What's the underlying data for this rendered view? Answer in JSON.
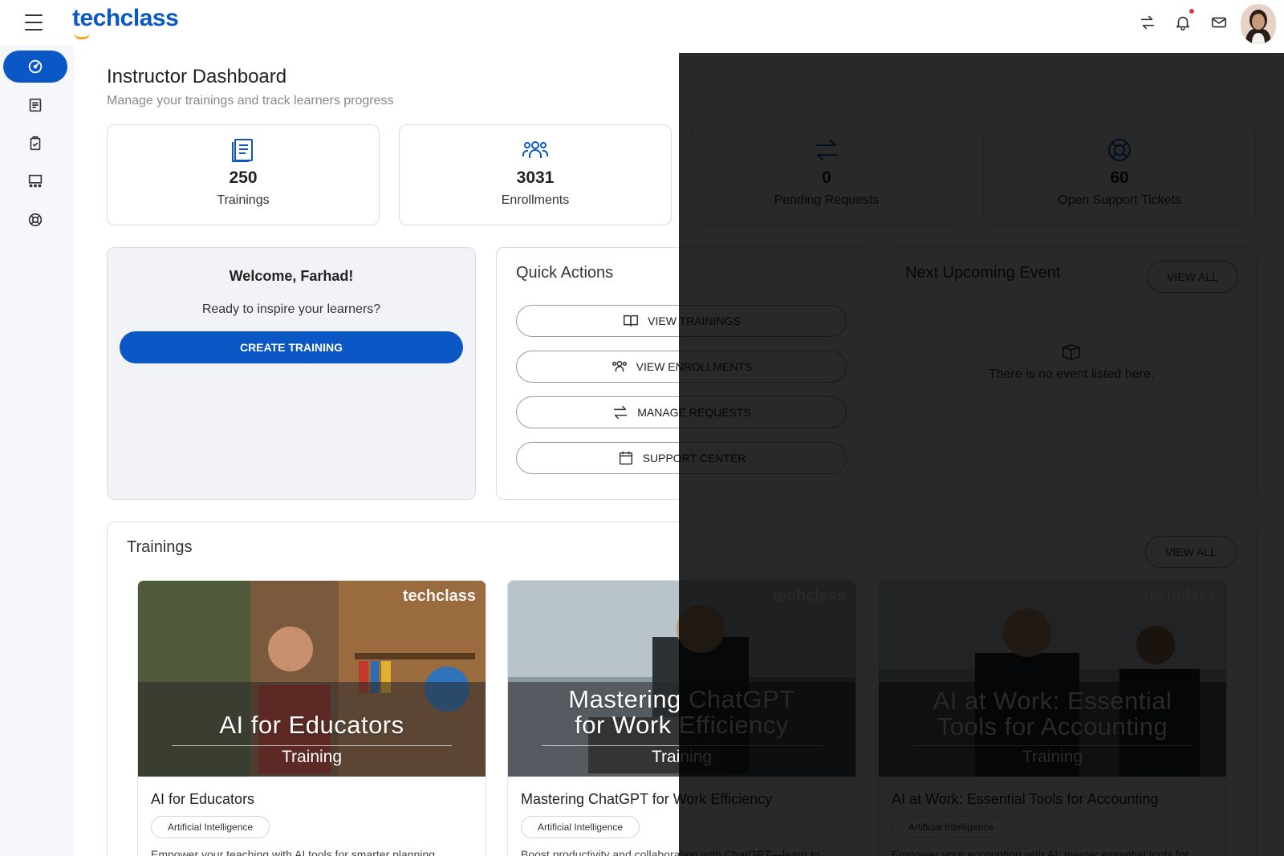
{
  "header": {
    "logo_text": "techclass",
    "brand_color": "#0b57c6",
    "accent_color": "#f5a623",
    "icons": [
      "menu-icon",
      "switch-role-icon",
      "bell-icon",
      "mail-icon"
    ]
  },
  "sidebar": {
    "items": [
      {
        "icon": "dashboard-icon",
        "active": true
      },
      {
        "icon": "book-icon",
        "active": false
      },
      {
        "icon": "clipboard-check-icon",
        "active": false
      },
      {
        "icon": "classroom-icon",
        "active": false
      },
      {
        "icon": "lifebuoy-icon",
        "active": false
      }
    ]
  },
  "page": {
    "title": "Instructor Dashboard",
    "subtitle": "Manage your trainings and track learners progress"
  },
  "stats": [
    {
      "value": "250",
      "label": "Trainings",
      "icon": "book-icon"
    },
    {
      "value": "3031",
      "label": "Enrollments",
      "icon": "users-icon"
    },
    {
      "value": "0",
      "label": "Pending Requests",
      "icon": "arrows-exchange-icon"
    },
    {
      "value": "60",
      "label": "Open Support Tickets",
      "icon": "lifebuoy-icon"
    }
  ],
  "welcome": {
    "title": "Welcome, Farhad!",
    "subtitle": "Ready to inspire your learners?",
    "button": "CREATE TRAINING"
  },
  "quick_actions": {
    "title": "Quick Actions",
    "buttons": [
      "VIEW TRAININGS",
      "VIEW ENROLLMENTS",
      "MANAGE REQUESTS",
      "SUPPORT CENTER"
    ]
  },
  "event": {
    "title": "Next Upcoming Event",
    "view_all": "VIEW ALL",
    "empty_text": "There is no event listed here."
  },
  "trainings": {
    "title": "Trainings",
    "view_all": "VIEW ALL",
    "items": [
      {
        "image_title_line1": "AI for Educators",
        "image_title_line2": "",
        "image_subtitle": "Training",
        "image_logo": "techclass",
        "name": "AI for Educators",
        "category": "Artificial Intelligence",
        "description": "Empower your teaching with AI tools for smarter planning,"
      },
      {
        "image_title_line1": "Mastering ChatGPT",
        "image_title_line2": "for Work Efficiency",
        "image_subtitle": "Training",
        "image_logo": "techclass",
        "name": "Mastering ChatGPT for Work Efficiency",
        "category": "Artificial Intelligence",
        "description": "Boost productivity and collaboration with ChatGPT—learn to"
      },
      {
        "image_title_line1": "AI at Work: Essential",
        "image_title_line2": "Tools for Accounting",
        "image_subtitle": "Training",
        "image_logo": "techclass",
        "name": "AI at Work: Essential Tools for Accounting",
        "category": "Artificial Intelligence",
        "description": "Empower your accounting with AI: master essential tools for"
      }
    ]
  }
}
